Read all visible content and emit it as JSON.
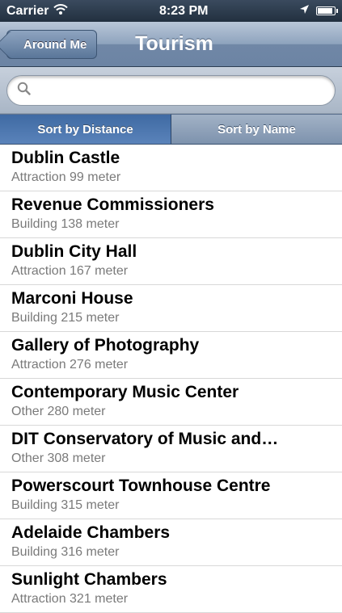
{
  "status": {
    "carrier": "Carrier",
    "time": "8:23 PM"
  },
  "nav": {
    "back_label": "Around Me",
    "title": "Tourism"
  },
  "search": {
    "placeholder": "",
    "value": ""
  },
  "sort": {
    "distance_label": "Sort by Distance",
    "name_label": "Sort by Name",
    "selected": "distance"
  },
  "items": [
    {
      "name": "Dublin Castle",
      "detail": "Attraction 99 meter"
    },
    {
      "name": "Revenue Commissioners",
      "detail": "Building 138 meter"
    },
    {
      "name": "Dublin City Hall",
      "detail": "Attraction 167 meter"
    },
    {
      "name": "Marconi House",
      "detail": "Building 215 meter"
    },
    {
      "name": "Gallery of Photography",
      "detail": "Attraction 276 meter"
    },
    {
      "name": "Contemporary Music Center",
      "detail": "Other 280 meter"
    },
    {
      "name": "DIT  Conservatory of Music and…",
      "detail": "Other 308 meter"
    },
    {
      "name": "Powerscourt Townhouse Centre",
      "detail": "Building 315 meter"
    },
    {
      "name": "Adelaide Chambers",
      "detail": "Building 316 meter"
    },
    {
      "name": "Sunlight Chambers",
      "detail": "Attraction 321 meter"
    }
  ]
}
